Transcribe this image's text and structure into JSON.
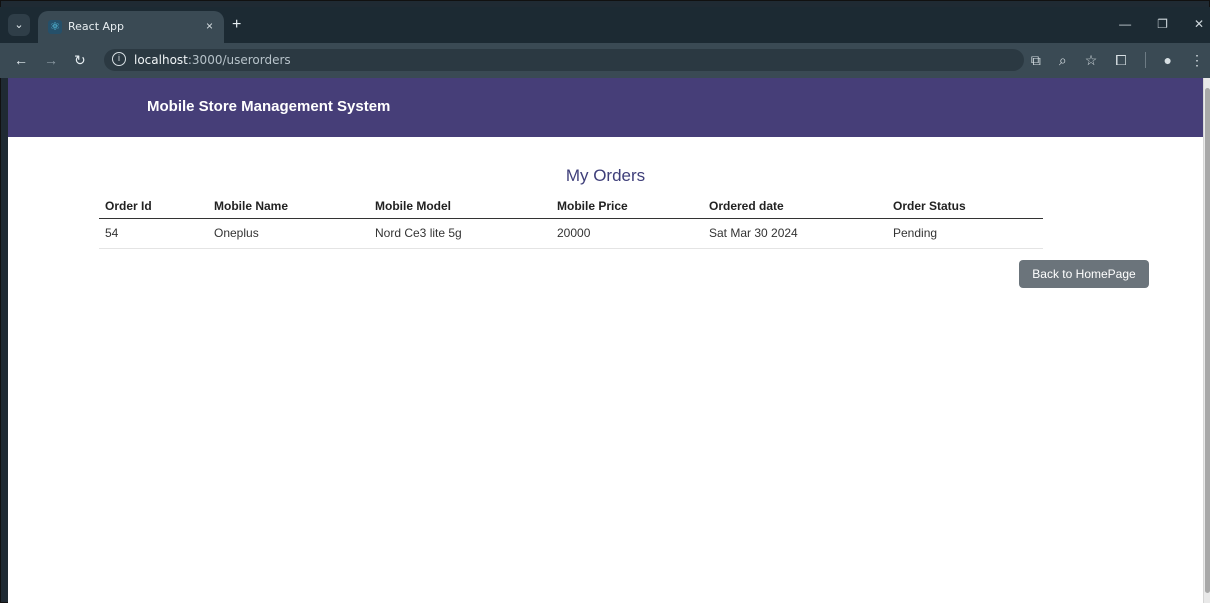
{
  "browser": {
    "tab_title": "React App",
    "tab_close": "×",
    "new_tab": "+",
    "url_host": "localhost",
    "url_path": ":3000/userorders",
    "window_controls": [
      "—",
      "❐",
      "✕"
    ]
  },
  "app": {
    "brand": "Mobile Store Management System",
    "heading": "My Orders",
    "table": {
      "headers": [
        "Order Id",
        "Mobile Name",
        "Mobile Model",
        "Mobile Price",
        "Ordered date",
        "Order Status"
      ],
      "rows": [
        [
          "54",
          "Oneplus",
          "Nord Ce3 lite 5g",
          "20000",
          "Sat Mar 30 2024",
          "Pending"
        ]
      ]
    },
    "back_button": "Back to HomePage"
  },
  "colors": {
    "header_bg": "#463e78",
    "heading": "#3f3f7a",
    "button_bg": "#6b747b"
  }
}
